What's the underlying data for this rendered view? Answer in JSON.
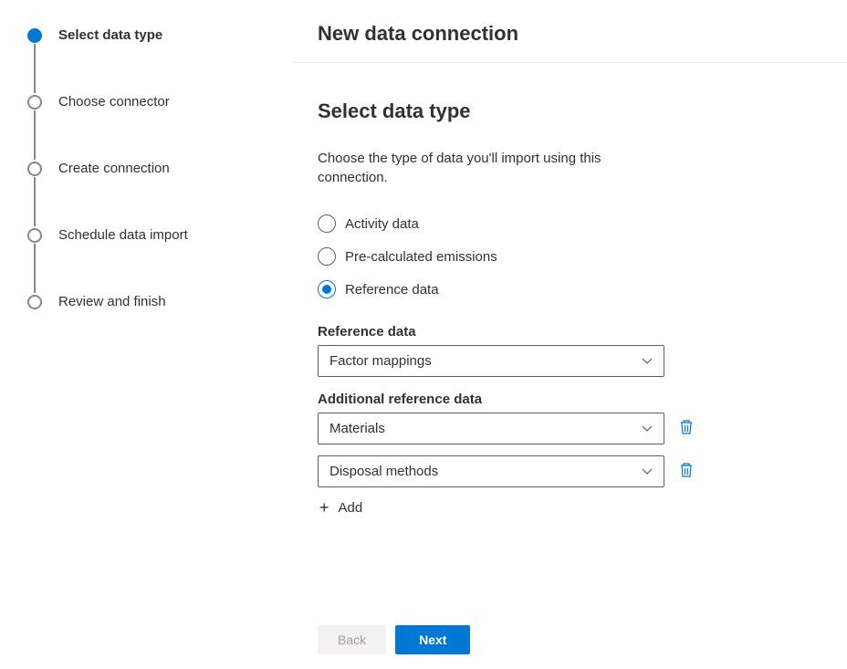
{
  "header": {
    "title": "New data connection"
  },
  "wizard": {
    "steps": [
      {
        "label": "Select data type",
        "active": true
      },
      {
        "label": "Choose connector",
        "active": false
      },
      {
        "label": "Create connection",
        "active": false
      },
      {
        "label": "Schedule data import",
        "active": false
      },
      {
        "label": "Review and finish",
        "active": false
      }
    ]
  },
  "page": {
    "title": "Select data type",
    "description": "Choose the type of data you'll import using this connection."
  },
  "radioOptions": [
    {
      "label": "Activity data",
      "selected": false
    },
    {
      "label": "Pre-calculated emissions",
      "selected": false
    },
    {
      "label": "Reference data",
      "selected": true
    }
  ],
  "referenceData": {
    "label": "Reference data",
    "value": "Factor mappings"
  },
  "additionalReference": {
    "label": "Additional reference data",
    "items": [
      {
        "value": "Materials"
      },
      {
        "value": "Disposal methods"
      }
    ],
    "addLabel": "Add"
  },
  "footer": {
    "backLabel": "Back",
    "nextLabel": "Next"
  },
  "colors": {
    "primary": "#0078d4",
    "border": "#605e5c"
  }
}
